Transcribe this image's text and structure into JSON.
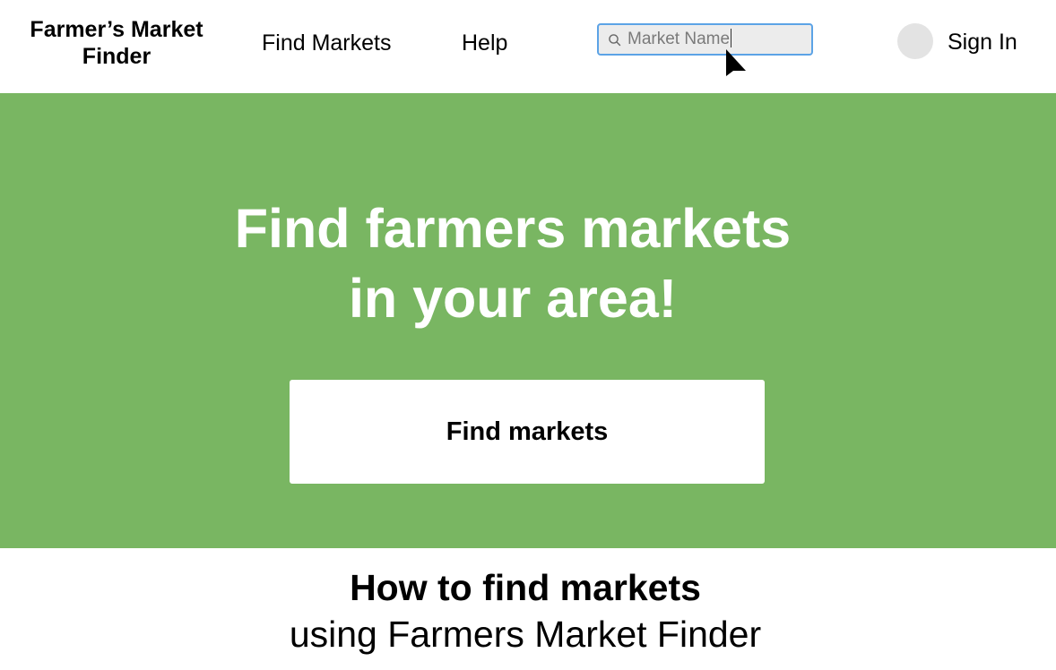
{
  "header": {
    "brand_line1": "Farmer’s Market",
    "brand_line2": "Finder",
    "nav": {
      "find_markets": "Find Markets",
      "help": "Help"
    },
    "search": {
      "value": "Market Name",
      "icon": "search-icon"
    },
    "sign_in": "Sign In"
  },
  "hero": {
    "title_line1": "Find farmers markets",
    "title_line2": "in your area!",
    "cta_label": "Find markets",
    "background_color": "#79b662"
  },
  "howto": {
    "title": "How to find markets",
    "subtitle": "using Farmers Market Finder"
  },
  "colors": {
    "search_border": "#5ca3e6",
    "search_bg": "#ececec",
    "avatar_bg": "#e3e3e3"
  }
}
